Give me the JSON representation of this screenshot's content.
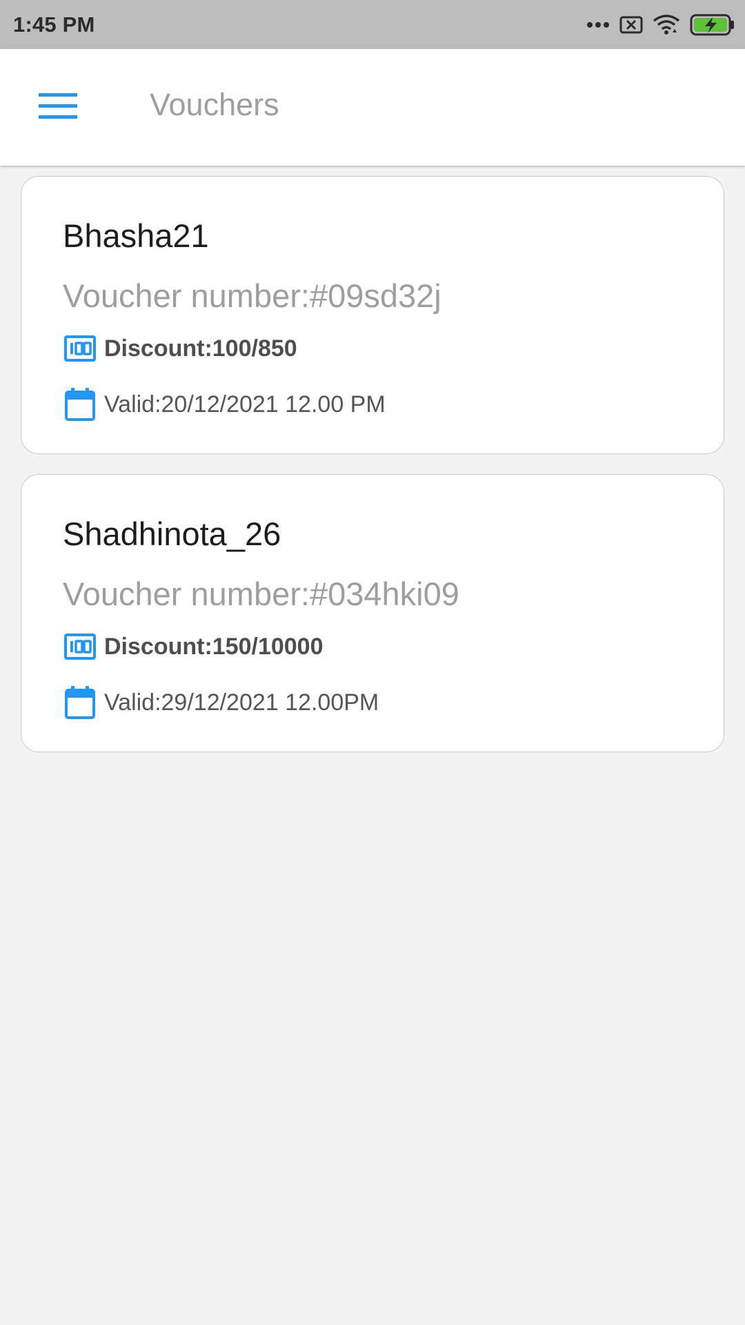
{
  "status_bar": {
    "time": "1:45 PM",
    "icons": [
      "more-dots-icon",
      "sim-missing-icon",
      "wifi-icon",
      "battery-charging-icon"
    ],
    "battery_color": "#5ec237"
  },
  "app_bar": {
    "title": "Vouchers",
    "menu_icon": "hamburger-menu-icon",
    "accent_color": "#2196f3"
  },
  "vouchers": [
    {
      "name": "Bhasha21",
      "voucher_number": "Voucher number:#09sd32j",
      "discount": "Discount:100/850",
      "valid": "Valid:20/12/2021 12.00 PM"
    },
    {
      "name": "Shadhinota_26",
      "voucher_number": "Voucher number:#034hki09",
      "discount": "Discount:150/10000",
      "valid": "Valid:29/12/2021 12.00PM"
    }
  ]
}
